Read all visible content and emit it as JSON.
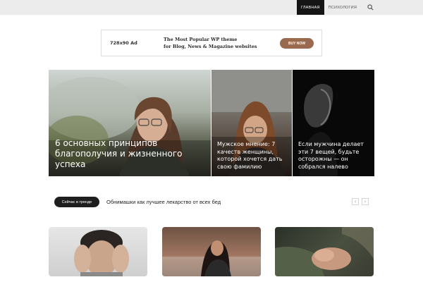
{
  "header": {
    "nav": [
      {
        "label": "Главная",
        "active": true
      },
      {
        "label": "Психология",
        "active": false
      }
    ],
    "search_icon": "search-icon"
  },
  "ad": {
    "size": "728x90 Ad",
    "line1": "The Most Popular WP theme",
    "line2": "for Blog, News & Magazine websites",
    "button": "BUY NOW",
    "button_color": "#9a6a4e"
  },
  "featured": [
    {
      "title": "6 основных принципов благополучия и жизненного успеха"
    },
    {
      "title": "Мужское мнение: 7 качеств женщины, которой хочется дать свою фамилию"
    },
    {
      "title": "Если мужчина делает эти 7 вещей, будьте осторожны — он собрался налево"
    }
  ],
  "trending": {
    "badge": "Сейчас в тренде",
    "headline": "Обнимашки как лучшее лекарство от всех бед",
    "prev_icon": "chevron-left-icon",
    "next_icon": "chevron-right-icon"
  },
  "colors": {
    "topbar_bg": "#ececec",
    "nav_active_bg": "#151515",
    "badge_bg": "#1e1e1e"
  }
}
